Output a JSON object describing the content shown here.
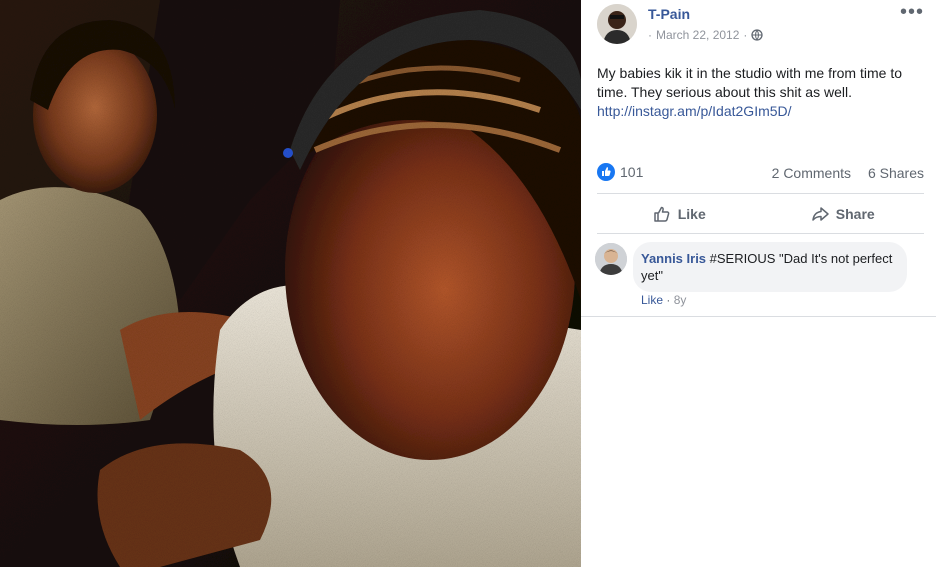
{
  "post": {
    "author": "T-Pain",
    "date": "March 22, 2012",
    "meta_separator": "·",
    "text": "My babies kik it in the studio with me from time to time. They serious about this shit as well.",
    "link": "http://instagr.am/p/Idat2GIm5D/",
    "more_label": "•••"
  },
  "stats": {
    "likes": "101",
    "comments": "2 Comments",
    "shares": "6 Shares"
  },
  "actions": {
    "like": "Like",
    "share": "Share"
  },
  "comment": {
    "author": "Yannis Iris",
    "text": " #SERIOUS \"Dad It's not perfect yet\"",
    "like_label": "Like",
    "separator": " · ",
    "time": "8y"
  },
  "icons": {
    "privacy": "globe-icon",
    "reaction": "thumbs-up-icon",
    "like_action": "thumbs-up-outline-icon",
    "share_action": "share-arrow-icon"
  },
  "colors": {
    "link": "#385898",
    "like_blue": "#1877f2",
    "muted": "#606770",
    "bubble": "#f2f3f5"
  }
}
